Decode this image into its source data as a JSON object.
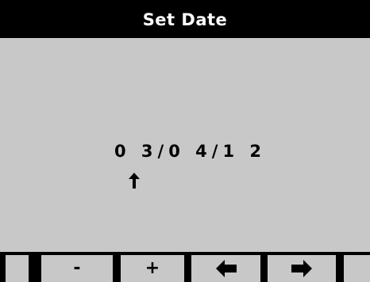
{
  "title": "Set Date",
  "date": {
    "month": "0 3",
    "sep1": "/",
    "day": "0 4",
    "sep2": "/",
    "year": "1 2"
  },
  "cursor_icon": "arrow-up-icon",
  "softkeys": [
    {
      "label": "",
      "icon": ""
    },
    {
      "label": "-",
      "icon": ""
    },
    {
      "label": "+",
      "icon": ""
    },
    {
      "label": "",
      "icon": "arrow-left-icon"
    },
    {
      "label": "",
      "icon": "arrow-right-icon"
    },
    {
      "label": "",
      "icon": ""
    }
  ],
  "colors": {
    "background": "#c8c8c8",
    "title_bar": "#000000",
    "title_text": "#ffffff",
    "text": "#000000"
  }
}
